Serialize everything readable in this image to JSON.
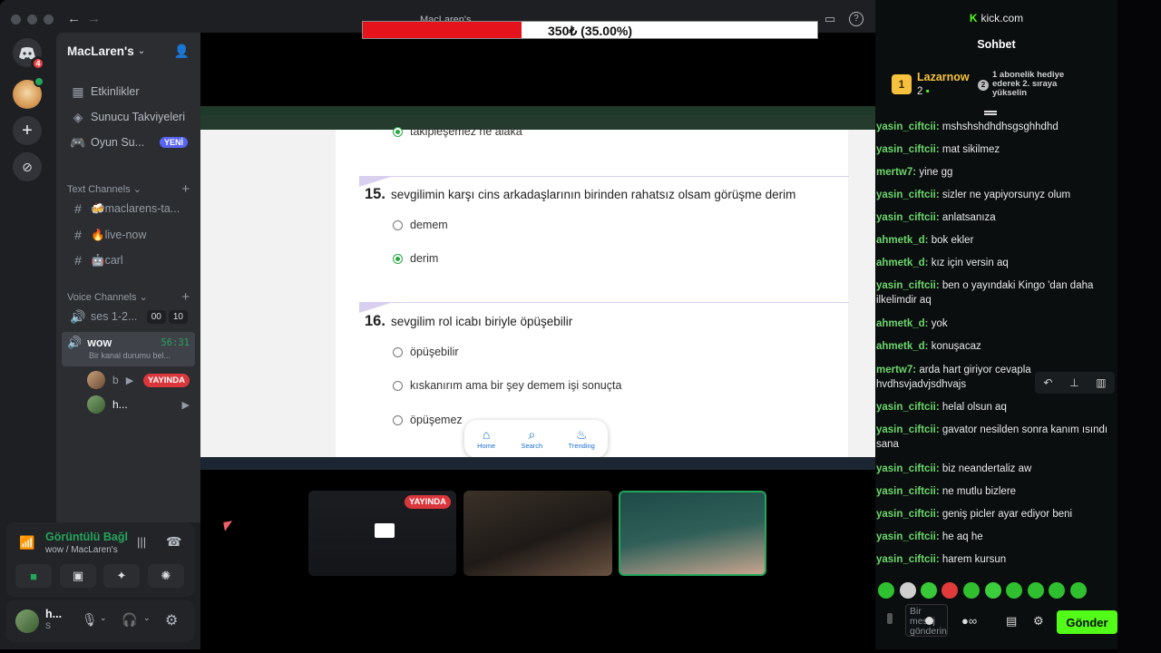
{
  "titlebar": {
    "share_title": "MacLaren's"
  },
  "progress": {
    "text": "350₺ (35.00%)",
    "fraction": 0.35
  },
  "server": {
    "name": "MacLaren's",
    "items": [
      {
        "label": "Etkinlikler",
        "icon": "calendar-icon"
      },
      {
        "label": "Sunucu Takviyeleri",
        "icon": "boost-icon"
      },
      {
        "label": "Oyun Su...",
        "icon": "controller-icon",
        "badge": "YENİ"
      }
    ],
    "text_channels_label": "Text Channels",
    "text_channels": [
      "🍻maclarens-ta...",
      "🔥live-now",
      "🤖carl"
    ],
    "voice_channels_label": "Voice Channels",
    "voice_channels": [
      {
        "name": "ses 1-2...",
        "a": "00",
        "b": "10"
      },
      {
        "name": "wow",
        "timer": "56:31",
        "status": "Bir kanal durumu bel..."
      }
    ],
    "voice_users": [
      {
        "name": "b",
        "live": "YAYINDA"
      },
      {
        "name": "h..."
      }
    ],
    "guild_badge": "4"
  },
  "voice_panel": {
    "title": "Görüntülü Bağl",
    "subtitle": "wow / MacLaren's"
  },
  "user_panel": {
    "name": "h...",
    "status": "S"
  },
  "quiz": {
    "prev_option": "takipleşemez ne alaka",
    "q15": {
      "num": "15.",
      "text": "sevgilimin karşı cins arkadaşlarının birinden rahatsız olsam görüşme derim",
      "options": [
        "demem",
        "derim"
      ]
    },
    "q16": {
      "num": "16.",
      "text": "sevgilim rol icabı biriyle öpüşebilir",
      "options": [
        "öpüşebilir",
        "kıskanırım ama bir şey demem işi sonuçta",
        "öpüşemez"
      ]
    },
    "nav": [
      "Home",
      "Search",
      "Trending"
    ]
  },
  "tiles": {
    "live_label": "YAYINDA"
  },
  "kick": {
    "domain": "kick.com",
    "title": "Sohbet",
    "top_user": "Lazarnow",
    "top_rank": "1",
    "top_count": "2",
    "gift_rank": "2",
    "gift_text": "1 abonelik hediye ederek 2. sıraya yükselin",
    "messages": [
      {
        "user": "yasin_ciftcii:",
        "text": "mshshshdhdhsgsghhdhd"
      },
      {
        "user": "yasin_ciftcii:",
        "text": "mat sikilmez"
      },
      {
        "user": "mertw7:",
        "text": "yine gg"
      },
      {
        "user": "yasin_ciftcii:",
        "text": "sizler ne yapiyorsunyz olum"
      },
      {
        "user": "yasin_ciftcii:",
        "text": "anlatsanıza"
      },
      {
        "user": "ahmetk_d:",
        "text": "bok ekler"
      },
      {
        "user": "ahmetk_d:",
        "text": "kız için versin aq"
      },
      {
        "user": "yasin_ciftcii:",
        "text": "ben o yayındaki Kingo 'dan daha ilkelimdir aq"
      },
      {
        "user": "ahmetk_d:",
        "text": "yok"
      },
      {
        "user": "ahmetk_d:",
        "text": "konuşacaz"
      },
      {
        "user": "mertw7:",
        "text": "arda hart giriyor cevapla hvdhsvjadvjsdhvajs"
      },
      {
        "user": "yasin_ciftcii:",
        "text": "helal olsun aq"
      },
      {
        "user": "yasin_ciftcii:",
        "text": "gavator nesilden sonra kanım ısındı sana"
      },
      {
        "user": "yasin_ciftcii:",
        "text": "biz neandertaliz aw"
      },
      {
        "user": "yasin_ciftcii:",
        "text": "ne mutlu bizlere"
      },
      {
        "user": "yasin_ciftcii:",
        "text": "geniş picler ayar ediyor beni"
      },
      {
        "user": "yasin_ciftcii:",
        "text": "he aq he"
      },
      {
        "user": "yasin_ciftcii:",
        "text": "harem kursun"
      }
    ],
    "input_placeholder": "Bir mesaj gönderin",
    "send_label": "Gönder"
  }
}
